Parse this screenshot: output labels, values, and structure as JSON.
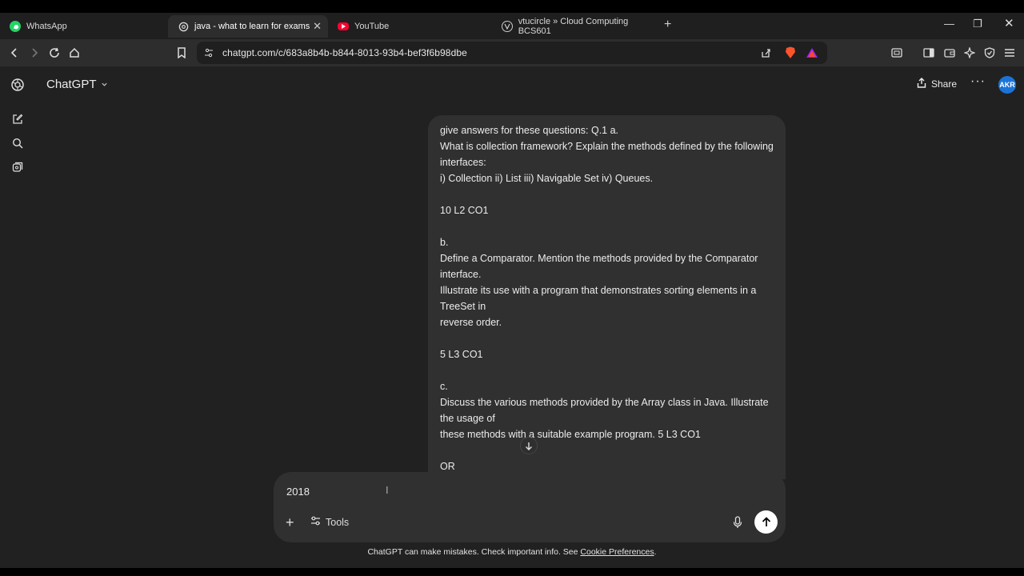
{
  "browser": {
    "tabs": [
      {
        "label": "WhatsApp",
        "icon": "whatsapp-icon",
        "color": "#25d366"
      },
      {
        "label": "java - what to learn for exams",
        "icon": "chatgpt-icon",
        "active": true
      },
      {
        "label": "YouTube",
        "icon": "youtube-icon",
        "color": "#ff0033"
      },
      {
        "label": "vtucircle » Cloud Computing BCS601",
        "icon": "vtucircle-icon"
      }
    ],
    "url": "chatgpt.com/c/683a8b4b-b844-8013-93b4-bef3f6b98dbe"
  },
  "app": {
    "model_name": "ChatGPT",
    "share_label": "Share",
    "avatar_initials": "AKR",
    "accent": "#1a73d9"
  },
  "message": {
    "text": "give answers for these questions: Q.1 a.\nWhat is collection framework? Explain the methods defined by the following interfaces:\ni) Collection ii) List iii) Navigable Set iv) Queues.\n\n10 L2 CO1\n\nb.\nDefine a Comparator. Mention the methods provided by the Comparator interface.\nIllustrate its use with a program that demonstrates sorting elements in a TreeSet in\nreverse order.\n\n5 L3 CO1\n\nc.\nDiscuss the various methods provided by the Array class in Java. Illustrate the usage of\nthese methods with a suitable example program. 5 L3 CO1\n\nOR"
  },
  "composer": {
    "value": "2018",
    "tools_label": "Tools"
  },
  "footer": {
    "disclaimer": "ChatGPT can make mistakes. Check important info. See ",
    "link_label": "Cookie Preferences",
    "end": "."
  }
}
